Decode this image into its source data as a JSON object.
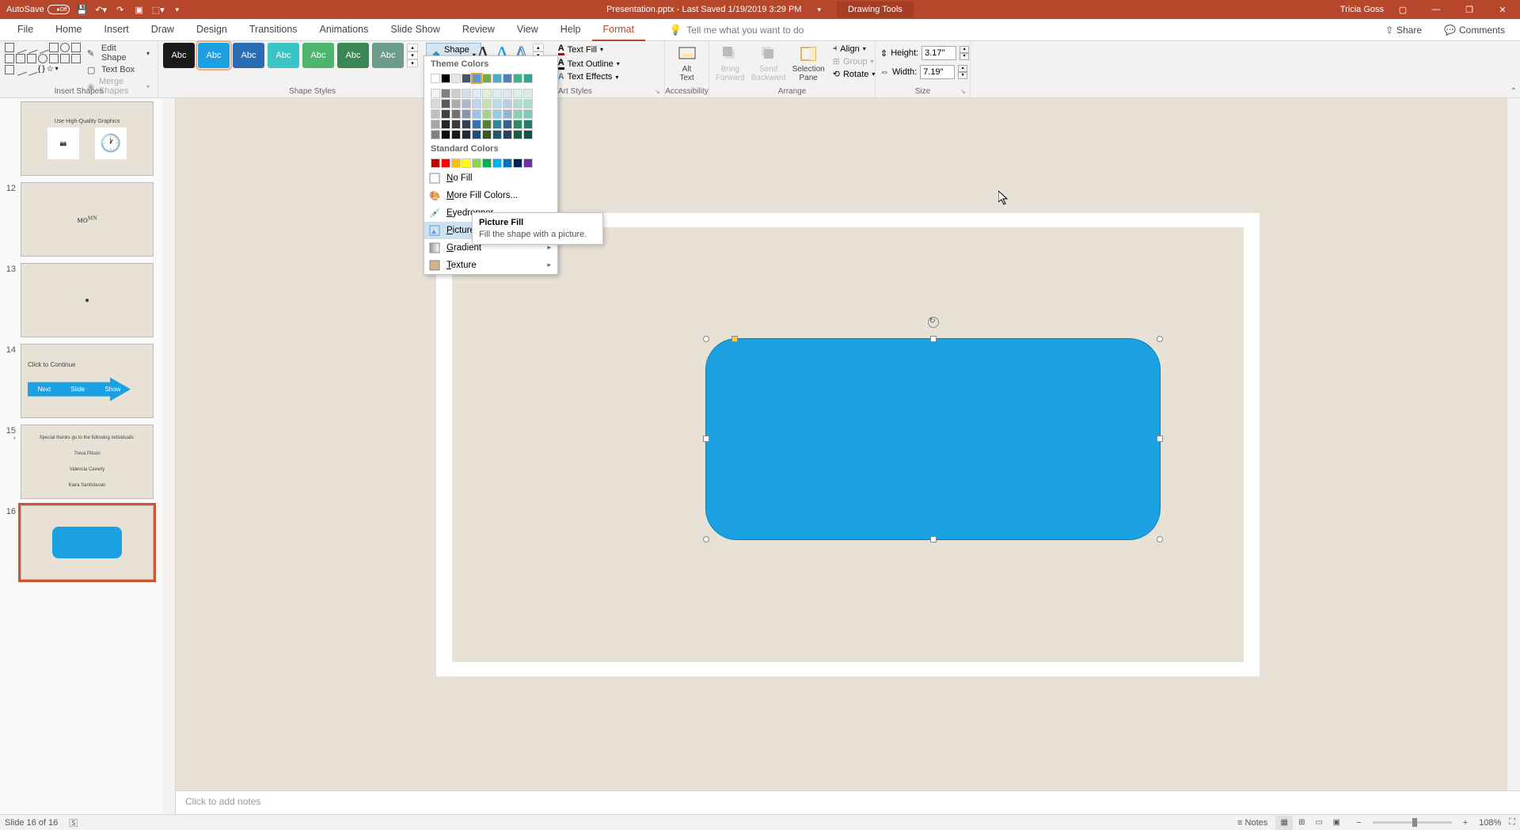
{
  "titlebar": {
    "autosave_label": "AutoSave",
    "autosave_state": "Off",
    "doc_title": "Presentation.pptx - Last Saved 1/19/2019 3:29 PM",
    "context_tab": "Drawing Tools",
    "user": "Tricia Goss"
  },
  "tabs": [
    "File",
    "Home",
    "Insert",
    "Draw",
    "Design",
    "Transitions",
    "Animations",
    "Slide Show",
    "Review",
    "View",
    "Help",
    "Format"
  ],
  "active_tab": "Format",
  "tell_me_placeholder": "Tell me what you want to do",
  "share": "Share",
  "comments": "Comments",
  "ribbon": {
    "insert_shapes": {
      "edit_shape": "Edit Shape",
      "text_box": "Text Box",
      "merge_shapes": "Merge Shapes",
      "label": "Insert Shapes"
    },
    "shape_styles": {
      "swatch_label": "Abc",
      "shape_fill": "Shape Fill",
      "label": "Shape Styles"
    },
    "wordart": {
      "text_fill": "Text Fill",
      "text_outline": "Text Outline",
      "text_effects": "Text Effects",
      "label": "WordArt Styles"
    },
    "accessibility": {
      "alt_text": "Alt\nText",
      "label": "Accessibility"
    },
    "arrange": {
      "bring_forward": "Bring\nForward",
      "send_backward": "Send\nBackward",
      "selection_pane": "Selection\nPane",
      "align": "Align",
      "group": "Group",
      "rotate": "Rotate",
      "label": "Arrange"
    },
    "size": {
      "height_label": "Height:",
      "height_val": "3.17\"",
      "width_label": "Width:",
      "width_val": "7.19\"",
      "label": "Size"
    }
  },
  "fill_dropdown": {
    "theme_colors": "Theme Colors",
    "standard_colors": "Standard Colors",
    "no_fill": "No Fill",
    "more_colors": "More Fill Colors...",
    "eyedropper": "Eyedropper",
    "picture": "Picture...",
    "gradient": "Gradient",
    "texture": "Texture"
  },
  "tooltip": {
    "title": "Picture Fill",
    "body": "Fill the shape with a picture."
  },
  "thumbnails": [
    {
      "num": "",
      "title": "Use High-Quality Graphics"
    },
    {
      "num": "12",
      "title": ""
    },
    {
      "num": "13",
      "title": ""
    },
    {
      "num": "14",
      "title": "Click to Continue",
      "arrow": [
        "Next",
        "Slide",
        "Show"
      ]
    },
    {
      "num": "15",
      "star": "*",
      "lines": [
        "Special thanks go to the following individuals:",
        "Treva Pitson",
        "Valencia Caverly",
        "Kiara Santistevan"
      ]
    },
    {
      "num": "16",
      "title": ""
    }
  ],
  "notes_placeholder": "Click to add notes",
  "statusbar": {
    "slide_info": "Slide 16 of 16",
    "notes": "Notes",
    "zoom": "108%"
  },
  "theme_colors_row1": [
    "#ffffff",
    "#000000",
    "#e7e6e6",
    "#44546a",
    "#5b9bd5",
    "#70ad47",
    "#4bacc6",
    "#4f81bd",
    "#3eb489",
    "#33a58c"
  ],
  "theme_tints": [
    [
      "#f2f2f2",
      "#7f7f7f",
      "#d0cece",
      "#d6dce5",
      "#deebf7",
      "#e2f0d9",
      "#daeef3",
      "#dce6f2",
      "#d7efe5",
      "#d4ede7"
    ],
    [
      "#d9d9d9",
      "#595959",
      "#aeabab",
      "#adb9ca",
      "#bdd7ee",
      "#c5e0b4",
      "#b7dee8",
      "#b9cde5",
      "#b0e0cc",
      "#aadccf"
    ],
    [
      "#bfbfbf",
      "#404040",
      "#757171",
      "#8497b0",
      "#9dc3e6",
      "#a9d18e",
      "#93cddd",
      "#95b3d7",
      "#88d0b2",
      "#80cab8"
    ],
    [
      "#a6a6a6",
      "#262626",
      "#3b3838",
      "#333f50",
      "#2e75b6",
      "#548235",
      "#31859c",
      "#376092",
      "#2a8a62",
      "#267a6a"
    ],
    [
      "#808080",
      "#0d0d0d",
      "#171717",
      "#222a35",
      "#1f4e79",
      "#385723",
      "#215968",
      "#254061",
      "#1c5c41",
      "#195147"
    ]
  ],
  "standard_colors": [
    "#c00000",
    "#ff0000",
    "#ffc000",
    "#ffff00",
    "#92d050",
    "#00b050",
    "#00b0f0",
    "#0070c0",
    "#002060",
    "#7030a0"
  ]
}
